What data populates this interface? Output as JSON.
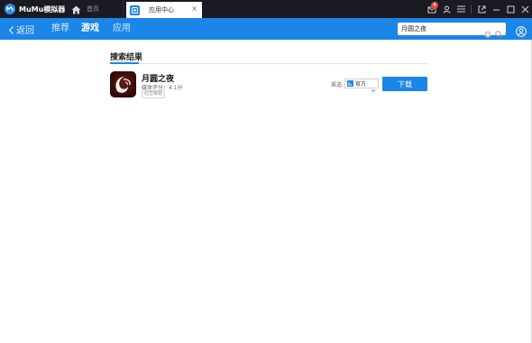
{
  "app": {
    "title": "MuMu模拟器"
  },
  "tabs": [
    {
      "label": "首页"
    },
    {
      "label": "应用中心"
    }
  ],
  "titlebar": {
    "notification_count": "4"
  },
  "nav": {
    "back_label": "返回",
    "items": [
      {
        "label": "推荐"
      },
      {
        "label": "游戏"
      },
      {
        "label": "应用"
      }
    ],
    "active_item": "游戏"
  },
  "search": {
    "value": "月圆之夜",
    "placeholder": ""
  },
  "results": {
    "title": "搜索结果",
    "items": [
      {
        "name": "月圆之夜",
        "rating": "媒体评分：4.1分",
        "tag": "经营策略",
        "channel_label": "渠道:",
        "channel": "官方",
        "download_label": "下载"
      }
    ]
  },
  "colors": {
    "titlebar_bg": "#1a1b22",
    "nav_bg": "#1b86e8",
    "accent": "#1b86e8",
    "badge": "#e8453c"
  }
}
